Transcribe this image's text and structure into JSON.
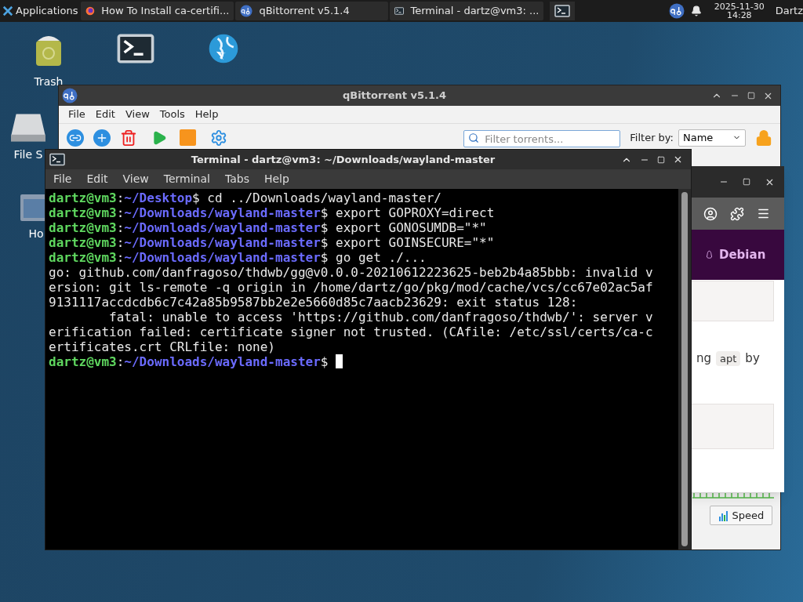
{
  "taskbar": {
    "menu_label": "Applications",
    "tasks": [
      {
        "kind": "browser",
        "label": "How To Install ca-certifi..."
      },
      {
        "kind": "qbittorrent",
        "label": "qBittorrent v5.1.4"
      },
      {
        "kind": "terminal",
        "label": "Terminal - dartz@vm3: ..."
      }
    ],
    "clock": {
      "date": "2025-11-30",
      "time": "14:28"
    },
    "user": "Dartz"
  },
  "desktop_icons": [
    {
      "kind": "trash",
      "label": "Trash"
    },
    {
      "kind": "terminal"
    },
    {
      "kind": "browser"
    },
    {
      "kind": "drive",
      "label": "File S"
    },
    {
      "kind": "home",
      "label": "Ho"
    }
  ],
  "qbittorrent": {
    "title": "qBittorrent v5.1.4",
    "menu": [
      "File",
      "Edit",
      "View",
      "Tools",
      "Help"
    ],
    "filter": {
      "placeholder": "Filter torrents..."
    },
    "filter_by_label": "Filter by:",
    "filter_by_value": "Name",
    "speed_button": "Speed"
  },
  "browser": {
    "site": "Debian",
    "text_before": "ng",
    "code": "apt",
    "text_after": "by"
  },
  "terminal": {
    "title": "Terminal - dartz@vm3: ~/Downloads/wayland-master",
    "menu": [
      "File",
      "Edit",
      "View",
      "Terminal",
      "Tabs",
      "Help"
    ],
    "lines": [
      {
        "kind": "prompt",
        "user": "dartz@vm3",
        "sep": ":",
        "path": "~/Desktop",
        "command": "$ cd ../Downloads/wayland-master/"
      },
      {
        "kind": "prompt",
        "user": "dartz@vm3",
        "sep": ":",
        "path": "~/Downloads/wayland-master",
        "command": "$ export GOPROXY=direct"
      },
      {
        "kind": "prompt",
        "user": "dartz@vm3",
        "sep": ":",
        "path": "~/Downloads/wayland-master",
        "command": "$ export GONOSUMDB=\"*\""
      },
      {
        "kind": "prompt",
        "user": "dartz@vm3",
        "sep": ":",
        "path": "~/Downloads/wayland-master",
        "command": "$ export GOINSECURE=\"*\""
      },
      {
        "kind": "prompt",
        "user": "dartz@vm3",
        "sep": ":",
        "path": "~/Downloads/wayland-master",
        "command": "$ go get ./..."
      },
      {
        "kind": "output",
        "text": "go: github.com/danfragoso/thdwb/gg@v0.0.0-20210612223625-beb2b4a85bbb: invalid v"
      },
      {
        "kind": "output",
        "text": "ersion: git ls-remote -q origin in /home/dartz/go/pkg/mod/cache/vcs/cc67e02ac5af"
      },
      {
        "kind": "output",
        "text": "9131117accdcdb6c7c42a85b9587bb2e2e5660d85c7aacb23629: exit status 128:"
      },
      {
        "kind": "output",
        "text": "        fatal: unable to access 'https://github.com/danfragoso/thdwb/': server v"
      },
      {
        "kind": "output",
        "text": "erification failed: certificate signer not trusted. (CAfile: /etc/ssl/certs/ca-c"
      },
      {
        "kind": "output",
        "text": "ertificates.crt CRLfile: none)"
      },
      {
        "kind": "prompt",
        "user": "dartz@vm3",
        "sep": ":",
        "path": "~/Downloads/wayland-master",
        "command": "$ ",
        "cursor": true
      }
    ]
  }
}
